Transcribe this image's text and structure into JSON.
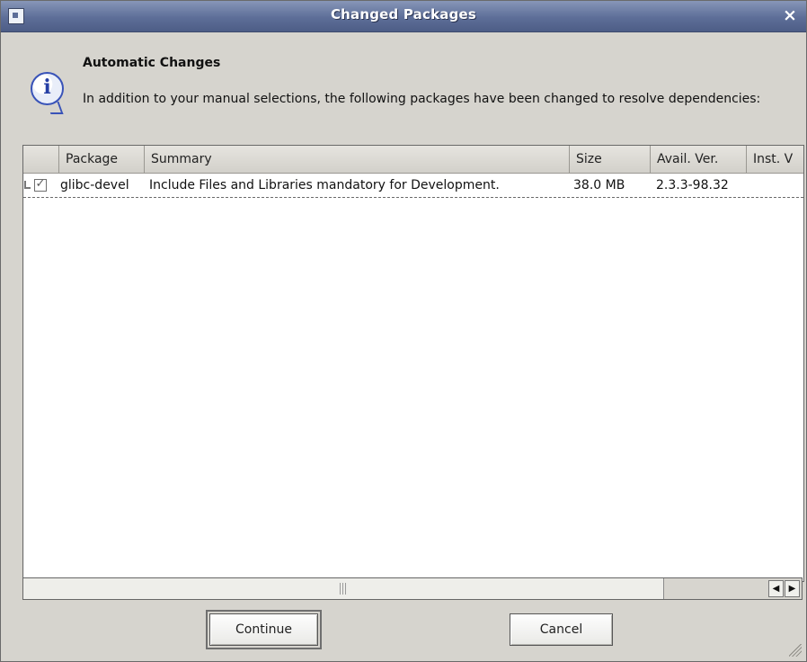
{
  "window": {
    "title": "Changed Packages",
    "close_symbol": "×"
  },
  "message": {
    "heading": "Automatic Changes",
    "body": "In addition to your manual selections, the following packages have been changed to resolve dependencies:"
  },
  "table": {
    "columns": [
      "",
      "Package",
      "Summary",
      "Size",
      "Avail. Ver.",
      "Inst. V"
    ],
    "rows": [
      {
        "checked": true,
        "package": "glibc-devel",
        "summary": "Include Files and Libraries mandatory for Development.",
        "size": "38.0 MB",
        "available_version": "2.3.3-98.32",
        "installed_version": ""
      }
    ]
  },
  "buttons": {
    "continue": "Continue",
    "cancel": "Cancel"
  },
  "colors": {
    "titlebar": "#5d6e98",
    "window_background": "#d6d4ce",
    "table_background": "#ffffff"
  },
  "icons": {
    "info": "info-icon",
    "close": "close-icon",
    "scroll_left": "left-arrow-icon",
    "scroll_right": "right-arrow-icon"
  }
}
